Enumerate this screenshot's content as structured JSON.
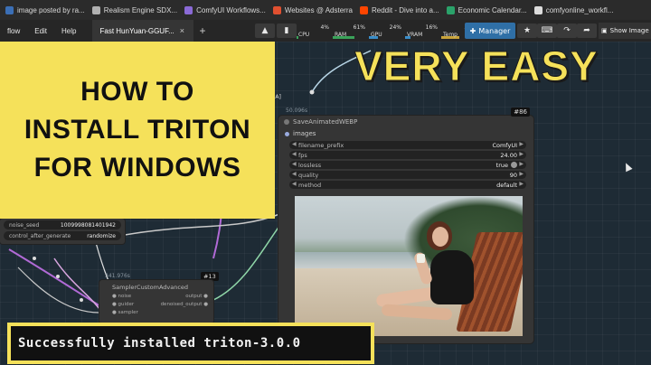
{
  "browser": {
    "bookmarks": [
      {
        "label": "image posted by ra...",
        "color": "#3b6fb6"
      },
      {
        "label": "Realism Engine SDX...",
        "color": "#b0b0b0"
      },
      {
        "label": "ComfyUI Workflows...",
        "color": "#8a6ad6"
      },
      {
        "label": "Websites @ Adsterra",
        "color": "#e05030"
      },
      {
        "label": "Reddit - Dive into a...",
        "color": "#ff4500"
      },
      {
        "label": "Economic Calendar...",
        "color": "#2aa26a"
      },
      {
        "label": "comfyonline_workfl...",
        "color": "#dddddd"
      }
    ]
  },
  "menu": {
    "workflow": "flow",
    "edit": "Edit",
    "help": "Help",
    "active_tab": "Fast HunYuan-GGUF...",
    "tab_close": "×",
    "tab_add": "+"
  },
  "stats": [
    {
      "label": "CPU",
      "value": "4%",
      "color": "#3aa35a",
      "fill": 0.04
    },
    {
      "label": "RAM",
      "value": "61%",
      "color": "#3aa35a",
      "fill": 0.61
    },
    {
      "label": "GPU",
      "value": "24%",
      "color": "#3a8ec9",
      "fill": 0.24
    },
    {
      "label": "VRAM",
      "value": "16%",
      "color": "#3a8ec9",
      "fill": 0.16
    },
    {
      "label": "Temp",
      "value": "50°",
      "color": "#c9a43a",
      "fill": 0.5
    }
  ],
  "toolbar": {
    "manager_label": "Manager",
    "show_image_label": "Show Image"
  },
  "overlay": {
    "title_lines": [
      "HOW TO",
      "INSTALL TRITON",
      "FOR WINDOWS"
    ],
    "very_easy": "VERY EASY",
    "success_text": "Successfully installed triton-3.0.0"
  },
  "save_node": {
    "id": "#86",
    "title": "SaveAnimatedWEBP",
    "input": "images",
    "above_label": "[A]",
    "timing": "50.096s",
    "widgets": [
      {
        "name": "filename_prefix",
        "value": "ComfyUI"
      },
      {
        "name": "fps",
        "value": "24.00"
      },
      {
        "name": "lossless",
        "value": "true"
      },
      {
        "name": "quality",
        "value": "90"
      },
      {
        "name": "method",
        "value": "default"
      }
    ]
  },
  "noise_node": {
    "rows": [
      {
        "name": "noise_seed",
        "value": "1009998081401942"
      },
      {
        "name": "control_after_generate",
        "value": "randomize"
      }
    ]
  },
  "sampler_node": {
    "id": "#13",
    "timing": "341.976s",
    "title": "SamplerCustomAdvanced",
    "inputs": [
      "noise",
      "guider",
      "sampler"
    ],
    "outputs": [
      "output",
      "denoised_output"
    ]
  }
}
